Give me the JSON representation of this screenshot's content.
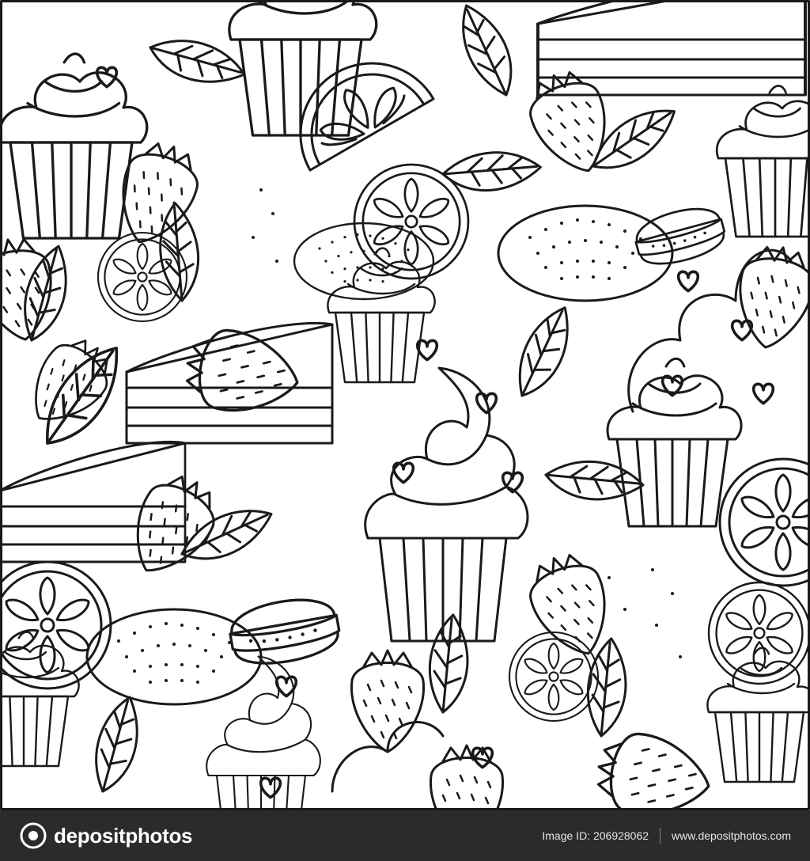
{
  "colors": {
    "line": "#1a1a1a",
    "paper": "#ffffff",
    "footer_bg": "#2b2b2b",
    "footer_text": "#ffffff"
  },
  "footer": {
    "brand": "depositphotos",
    "image_id": "Image ID: 206928062",
    "site": "www.depositphotos.com"
  },
  "icons": {
    "logo": "depositphotos-logo-mark"
  }
}
